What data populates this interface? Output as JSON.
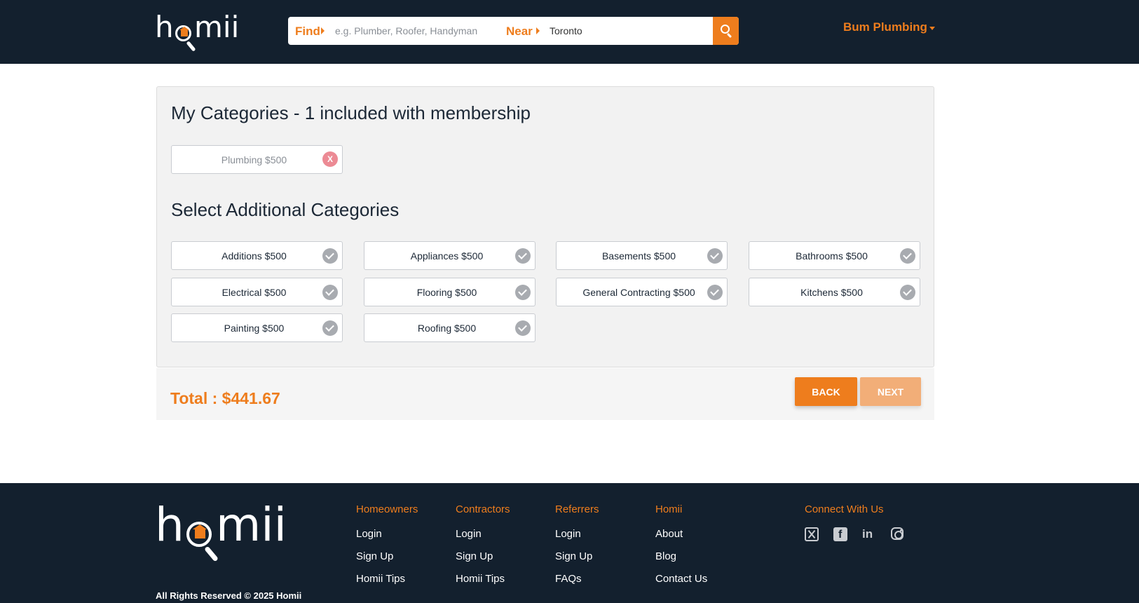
{
  "header": {
    "logo_text": "homii",
    "find_label": "Find",
    "find_placeholder": "e.g. Plumber, Roofer, Handyman",
    "near_label": "Near",
    "near_value": "Toronto",
    "user_menu_label": "Bum Plumbing"
  },
  "my_categories": {
    "title": "My Categories - 1 included with membership",
    "items": [
      {
        "label": "Plumbing $500",
        "remove_label": "X"
      }
    ]
  },
  "additional": {
    "title": "Select Additional Categories",
    "items": [
      {
        "label": "Additions $500"
      },
      {
        "label": "Appliances $500"
      },
      {
        "label": "Basements $500"
      },
      {
        "label": "Bathrooms $500"
      },
      {
        "label": "Electrical $500"
      },
      {
        "label": "Flooring $500"
      },
      {
        "label": "General Contracting $500"
      },
      {
        "label": "Kitchens $500"
      },
      {
        "label": "Painting $500"
      },
      {
        "label": "Roofing $500"
      }
    ]
  },
  "summary": {
    "total_text": "Total : $441.67",
    "back_label": "BACK",
    "next_label": "NEXT"
  },
  "footer": {
    "logo_text": "homii",
    "copyright": "All Rights Reserved © 2025 Homii",
    "columns": [
      {
        "heading": "Homeowners",
        "links": [
          "Login",
          "Sign Up",
          "Homii Tips"
        ]
      },
      {
        "heading": "Contractors",
        "links": [
          "Login",
          "Sign Up",
          "Homii Tips"
        ]
      },
      {
        "heading": "Referrers",
        "links": [
          "Login",
          "Sign Up",
          "FAQs"
        ]
      },
      {
        "heading": "Homii",
        "links": [
          "About",
          "Blog",
          "Contact Us"
        ]
      }
    ],
    "connect_heading": "Connect With Us",
    "social_icons": [
      "x-icon",
      "facebook-icon",
      "linkedin-icon",
      "instagram-icon"
    ],
    "linkedin_glyph": "in"
  },
  "colors": {
    "navy": "#13202e",
    "accent": "#ee7d1d",
    "accent_light": "#f2ae78",
    "remove_red": "#ec8a94",
    "check_gray": "#a8abb0"
  }
}
